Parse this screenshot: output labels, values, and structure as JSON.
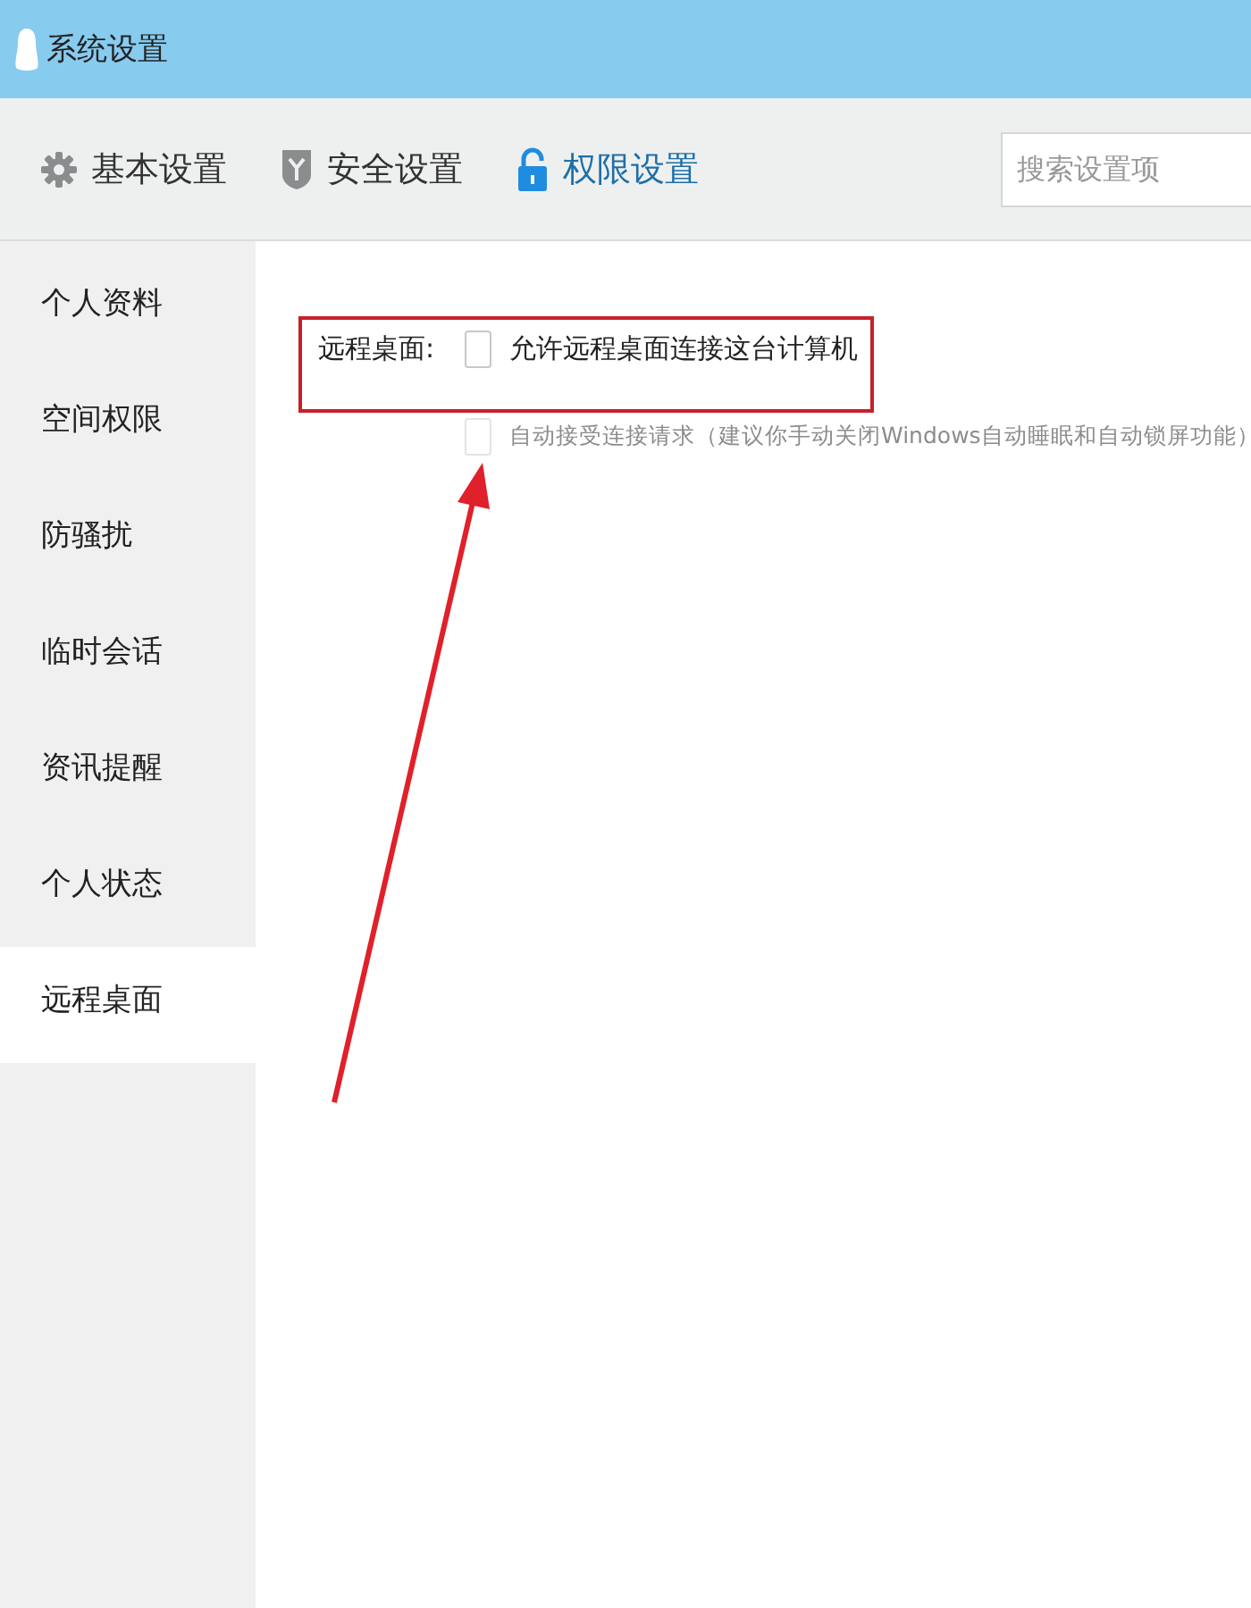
{
  "window": {
    "title": "系统设置"
  },
  "tabs": [
    {
      "label": "基本设置",
      "selected": false
    },
    {
      "label": "安全设置",
      "selected": false
    },
    {
      "label": "权限设置",
      "selected": true
    }
  ],
  "search": {
    "placeholder": "搜索设置项"
  },
  "sidebar": {
    "items": [
      {
        "label": "个人资料",
        "selected": false
      },
      {
        "label": "空间权限",
        "selected": false
      },
      {
        "label": "防骚扰",
        "selected": false
      },
      {
        "label": "临时会话",
        "selected": false
      },
      {
        "label": "资讯提醒",
        "selected": false
      },
      {
        "label": "个人状态",
        "selected": false
      },
      {
        "label": "远程桌面",
        "selected": true
      }
    ]
  },
  "setting": {
    "label": "远程桌面:",
    "options": [
      {
        "label": "允许远程桌面连接这台计算机",
        "checked": false,
        "disabled": false
      },
      {
        "label": "自动接受连接请求（建议你手动关闭Windows自动睡眠和自动锁屏功能）",
        "checked": false,
        "disabled": true
      }
    ]
  }
}
